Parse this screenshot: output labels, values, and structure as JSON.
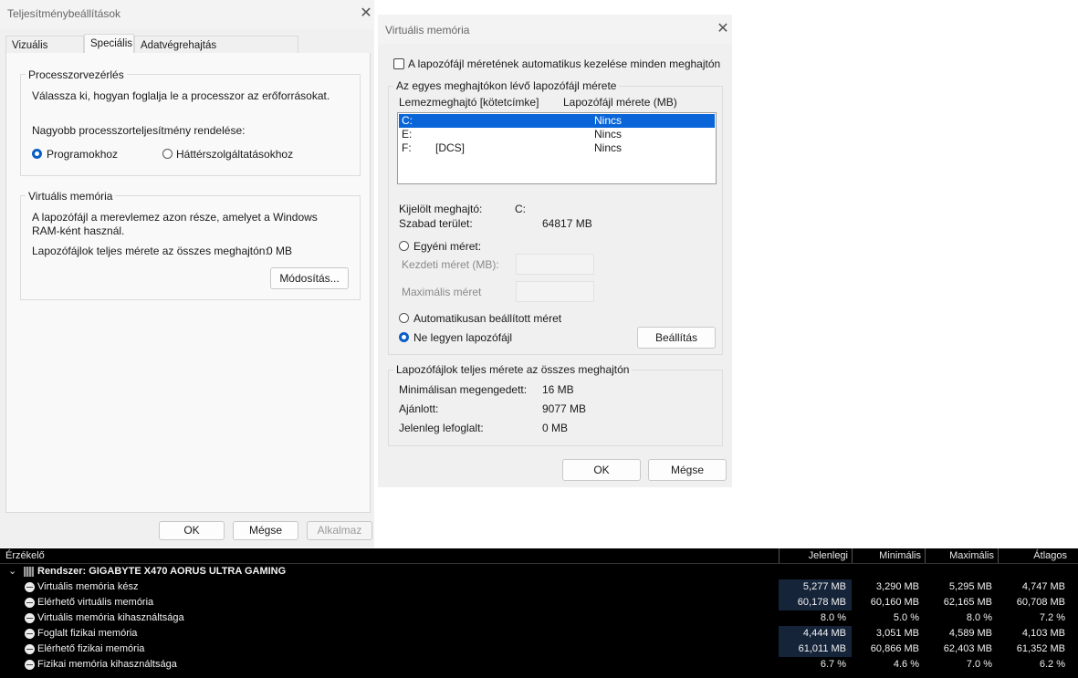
{
  "perf_window": {
    "title": "Teljesítménybeállítások",
    "tabs": [
      "Vizuális hatások",
      "Speciális",
      "Adatvégrehajtás megakadályozása"
    ],
    "active_tab": "Speciális",
    "processor": {
      "group_label": "Processzorvezérlés",
      "description": "Válassza ki, hogyan foglalja le a processzor az erőforrásokat.",
      "prompt": "Nagyobb processzorteljesítmény rendelése:",
      "option_programs": "Programokhoz",
      "option_services": "Háttérszolgáltatásokhoz",
      "selected": "Programokhoz"
    },
    "virtual_memory": {
      "group_label": "Virtuális memória",
      "description_line1": "A lapozófájl a merevlemez azon része, amelyet a Windows",
      "description_line2": "RAM-ként használ.",
      "total_label": "Lapozófájlok teljes mérete az összes meghajtón:",
      "total_value": "0 MB",
      "change_button": "Módosítás..."
    },
    "buttons": {
      "ok": "OK",
      "cancel": "Mégse",
      "apply": "Alkalmaz"
    }
  },
  "vm_dialog": {
    "title": "Virtuális memória",
    "auto_manage_label": "A lapozófájl méretének automatikus kezelése minden meghajtón",
    "auto_manage_checked": false,
    "drives_group_label": "Az egyes meghajtókon lévő lapozófájl mérete",
    "col_drive": "Lemezmeghajtó [kötetcímke]",
    "col_size": "Lapozófájl mérete (MB)",
    "drives": [
      {
        "drive": "C:",
        "label": "",
        "size": "Nincs",
        "selected": true
      },
      {
        "drive": "E:",
        "label": "",
        "size": "Nincs",
        "selected": false
      },
      {
        "drive": "F:",
        "label": "[DCS]",
        "size": "Nincs",
        "selected": false
      }
    ],
    "selected_drive_label": "Kijelölt meghajtó:",
    "selected_drive_value": "C:",
    "free_space_label": "Szabad terület:",
    "free_space_value": "64817  MB",
    "custom_size_label": "Egyéni méret:",
    "initial_size_label": "Kezdeti méret (MB):",
    "max_size_label": "Maximális méret",
    "initial_size_value": "",
    "max_size_value": "",
    "system_managed_label": "Automatikusan beállított méret",
    "no_paging_label": "Ne legyen lapozófájl",
    "selected_option": "no_paging",
    "set_button": "Beállítás",
    "totals_group_label": "Lapozófájlok teljes mérete az összes meghajtón",
    "min_allowed_label": "Minimálisan megengedett:",
    "min_allowed_value": "16  MB",
    "recommended_label": "Ajánlott:",
    "recommended_value": "9077  MB",
    "current_label": "Jelenleg lefoglalt:",
    "current_value": "0  MB",
    "ok": "OK",
    "cancel": "Mégse"
  },
  "sensors": {
    "columns": [
      "Érzékelő",
      "Jelenlegi",
      "Minimális",
      "Maximális",
      "Átlagos"
    ],
    "system_label": "Rendszer: GIGABYTE X470 AORUS ULTRA GAMING",
    "rows": [
      {
        "name": "Virtuális memória kész",
        "current": "5,277 MB",
        "min": "3,290 MB",
        "max": "5,295 MB",
        "avg": "4,747 MB",
        "highlight": true
      },
      {
        "name": "Elérhető virtuális memória",
        "current": "60,178 MB",
        "min": "60,160 MB",
        "max": "62,165 MB",
        "avg": "60,708 MB",
        "highlight": true
      },
      {
        "name": "Virtuális memória kihasználtsága",
        "current": "8.0 %",
        "min": "5.0 %",
        "max": "8.0 %",
        "avg": "7.2 %",
        "highlight": false
      },
      {
        "name": "Foglalt fizikai memória",
        "current": "4,444 MB",
        "min": "3,051 MB",
        "max": "4,589 MB",
        "avg": "4,103 MB",
        "highlight": true
      },
      {
        "name": "Elérhető fizikai memória",
        "current": "61,011 MB",
        "min": "60,866 MB",
        "max": "62,403 MB",
        "avg": "61,352 MB",
        "highlight": true
      },
      {
        "name": "Fizikai memória kihasználtsága",
        "current": "6.7 %",
        "min": "4.6 %",
        "max": "7.0 %",
        "avg": "6.2 %",
        "highlight": false
      }
    ]
  }
}
